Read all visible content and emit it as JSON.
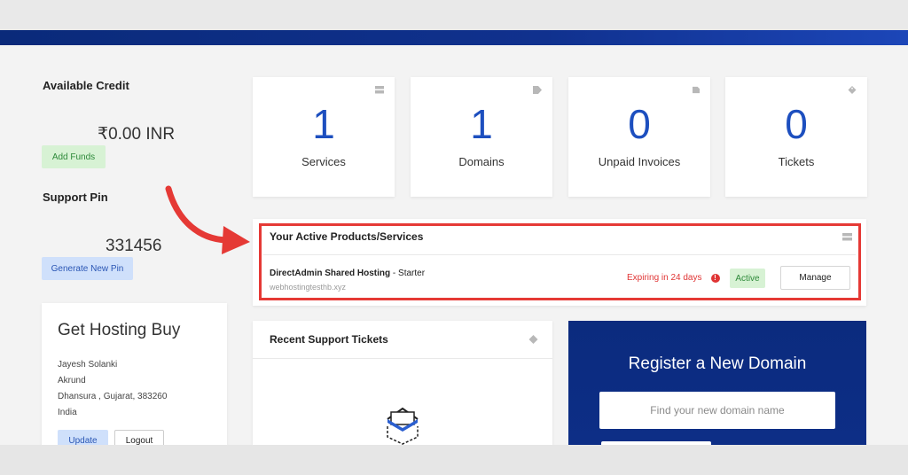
{
  "sidebar": {
    "credit_title": "Available Credit",
    "credit_value": "₹0.00 INR",
    "add_funds_label": "Add Funds",
    "pin_title": "Support Pin",
    "pin_value": "331456",
    "generate_pin_label": "Generate New Pin"
  },
  "client": {
    "title": "Get Hosting Buy",
    "name": "Jayesh Solanki",
    "company": "Akrund",
    "address": "Dhansura , Gujarat, 383260",
    "country": "India",
    "update_label": "Update",
    "logout_label": "Logout"
  },
  "stats": [
    {
      "count": "1",
      "label": "Services",
      "icon": "server-icon"
    },
    {
      "count": "1",
      "label": "Domains",
      "icon": "tag-icon"
    },
    {
      "count": "0",
      "label": "Unpaid Invoices",
      "icon": "document-icon"
    },
    {
      "count": "0",
      "label": "Tickets",
      "icon": "ticket-icon"
    }
  ],
  "products": {
    "title": "Your Active Products/Services",
    "item": {
      "name": "DirectAdmin Shared Hosting",
      "plan": " - Starter",
      "domain": "webhostingtesthb.xyz",
      "expiry": "Expiring in 24 days",
      "status": "Active",
      "manage_label": "Manage"
    }
  },
  "tickets": {
    "title": "Recent Support Tickets"
  },
  "domain_register": {
    "title": "Register a New Domain",
    "placeholder": "Find your new domain name"
  },
  "colors": {
    "brand_blue": "#1d4fbf",
    "navy": "#0b2b7e",
    "highlight_red": "#e53935",
    "success_green": "#2e8a3a"
  }
}
